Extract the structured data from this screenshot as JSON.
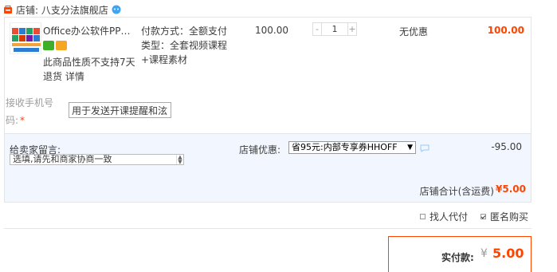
{
  "shop": {
    "name": "店铺: 八支分法旗舰店"
  },
  "item": {
    "title": "Office办公软件PPT…",
    "no_return_text": "此商品性质不支持7天退货",
    "detail_link": "详情",
    "pay_type": "付款方式：全额支付 类型：全套视频课程+课程素材",
    "price": "100.00",
    "quantity": "1",
    "qty_minus": "-",
    "qty_plus": "+",
    "discount": "无优惠",
    "subtotal": "100.00"
  },
  "phone": {
    "label": "接收手机号码:",
    "required_mark": "*",
    "value": "用于发送开课提醒和泫"
  },
  "remark": {
    "label": "给卖家留言:",
    "value": "选填,请先和商家协商一致"
  },
  "promo": {
    "label": "店铺优惠:",
    "selected": "省95元:内部专享券HHOFF",
    "caret": "▼",
    "amount": "-95.00"
  },
  "shop_total": {
    "label": "店铺合计(含运费)",
    "amount": "¥5.00"
  },
  "options": {
    "proxy_pay": "找人代付",
    "anonymous": "匿名购买",
    "proxy_pay_checked": false,
    "anonymous_checked": true
  },
  "payment": {
    "label": "实付款:",
    "currency": "¥",
    "amount": "5.00"
  },
  "colors": {
    "accent": "#ff4400",
    "light_blue_bg": "#f2f7ff"
  }
}
